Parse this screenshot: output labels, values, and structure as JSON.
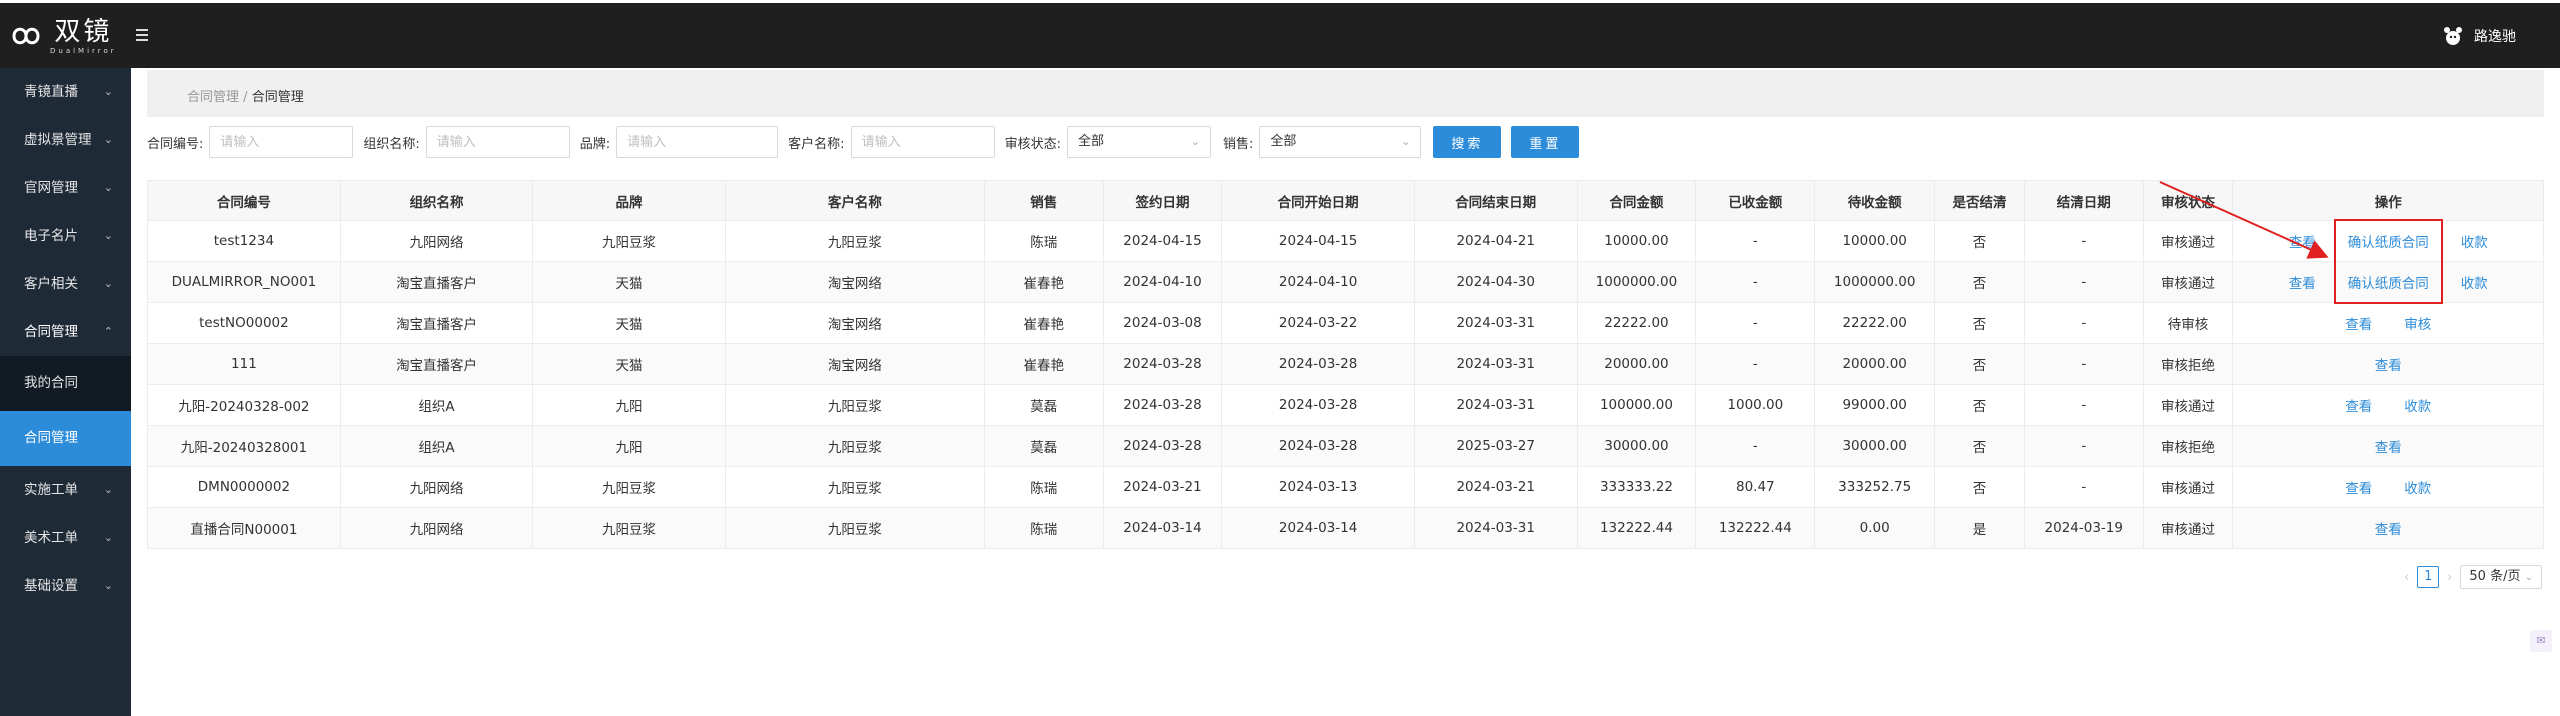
{
  "header": {
    "logo_cn": "双镜",
    "logo_en": "DualMirror",
    "user_name": "路逸驰"
  },
  "sidebar": {
    "items": [
      {
        "label": "青镜直播"
      },
      {
        "label": "虚拟景管理"
      },
      {
        "label": "官网管理"
      },
      {
        "label": "电子名片"
      },
      {
        "label": "客户相关"
      },
      {
        "label": "合同管理"
      },
      {
        "label": "我的合同"
      },
      {
        "label": "合同管理"
      },
      {
        "label": "实施工单"
      },
      {
        "label": "美术工单"
      },
      {
        "label": "基础设置"
      }
    ]
  },
  "breadcrumb": {
    "parent": "合同管理",
    "sep": "/",
    "current": "合同管理"
  },
  "filters": {
    "contract_no_label": "合同编号:",
    "org_label": "组织名称:",
    "brand_label": "品牌:",
    "customer_label": "客户名称:",
    "status_label": "审核状态:",
    "sales_label": "销售:",
    "placeholder": "请输入",
    "status_value": "全部",
    "sales_value": "全部",
    "search_btn": "搜索",
    "reset_btn": "重置"
  },
  "table": {
    "headers": [
      "合同编号",
      "组织名称",
      "品牌",
      "客户名称",
      "销售",
      "签约日期",
      "合同开始日期",
      "合同结束日期",
      "合同金额",
      "已收金额",
      "待收金额",
      "是否结清",
      "结清日期",
      "审核状态",
      "操作"
    ],
    "rows": [
      {
        "cells": [
          "test1234",
          "九阳网络",
          "九阳豆浆",
          "九阳豆浆",
          "陈瑞",
          "2024-04-15",
          "2024-04-15",
          "2024-04-21",
          "10000.00",
          "-",
          "10000.00",
          "否",
          "-",
          "审核通过"
        ],
        "ops": [
          "查看",
          "确认纸质合同",
          "收款"
        ]
      },
      {
        "cells": [
          "DUALMIRROR_NO001",
          "淘宝直播客户",
          "天猫",
          "淘宝网络",
          "崔春艳",
          "2024-04-10",
          "2024-04-10",
          "2024-04-30",
          "1000000.00",
          "-",
          "1000000.00",
          "否",
          "-",
          "审核通过"
        ],
        "ops": [
          "查看",
          "确认纸质合同",
          "收款"
        ]
      },
      {
        "cells": [
          "testNO00002",
          "淘宝直播客户",
          "天猫",
          "淘宝网络",
          "崔春艳",
          "2024-03-08",
          "2024-03-22",
          "2024-03-31",
          "22222.00",
          "-",
          "22222.00",
          "否",
          "-",
          "待审核"
        ],
        "ops": [
          "查看",
          "审核"
        ]
      },
      {
        "cells": [
          "111",
          "淘宝直播客户",
          "天猫",
          "淘宝网络",
          "崔春艳",
          "2024-03-28",
          "2024-03-28",
          "2024-03-31",
          "20000.00",
          "-",
          "20000.00",
          "否",
          "-",
          "审核拒绝"
        ],
        "ops": [
          "查看"
        ]
      },
      {
        "cells": [
          "九阳-20240328-002",
          "组织A",
          "九阳",
          "九阳豆浆",
          "莫磊",
          "2024-03-28",
          "2024-03-28",
          "2024-03-31",
          "100000.00",
          "1000.00",
          "99000.00",
          "否",
          "-",
          "审核通过"
        ],
        "ops": [
          "查看",
          "收款"
        ]
      },
      {
        "cells": [
          "九阳-20240328001",
          "组织A",
          "九阳",
          "九阳豆浆",
          "莫磊",
          "2024-03-28",
          "2024-03-28",
          "2025-03-27",
          "30000.00",
          "-",
          "30000.00",
          "否",
          "-",
          "审核拒绝"
        ],
        "ops": [
          "查看"
        ]
      },
      {
        "cells": [
          "DMN0000002",
          "九阳网络",
          "九阳豆浆",
          "九阳豆浆",
          "陈瑞",
          "2024-03-21",
          "2024-03-13",
          "2024-03-21",
          "333333.22",
          "80.47",
          "333252.75",
          "否",
          "-",
          "审核通过"
        ],
        "ops": [
          "查看",
          "收款"
        ]
      },
      {
        "cells": [
          "直播合同N00001",
          "九阳网络",
          "九阳豆浆",
          "九阳豆浆",
          "陈瑞",
          "2024-03-14",
          "2024-03-14",
          "2024-03-31",
          "132222.44",
          "132222.44",
          "0.00",
          "是",
          "2024-03-19",
          "审核通过"
        ],
        "ops": [
          "查看"
        ]
      }
    ]
  },
  "pagination": {
    "current_page": "1",
    "page_size": "50 条/页",
    "prev": "‹",
    "next": "›"
  },
  "colors": {
    "accent": "#2d8cd9",
    "highlight": "#e02020",
    "sidebar": "#1f2a37",
    "topbar": "#1f1f1f"
  }
}
